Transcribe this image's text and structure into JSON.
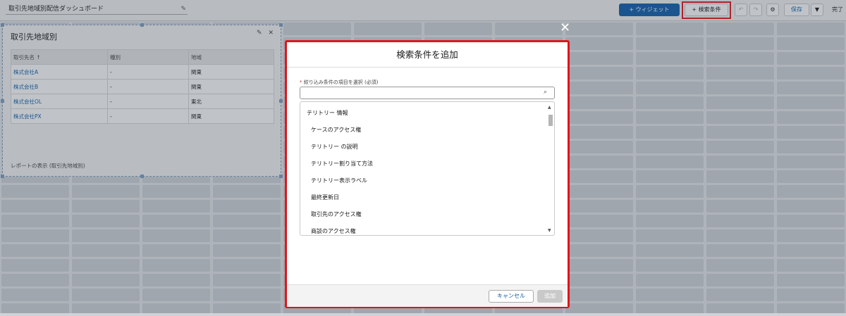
{
  "header": {
    "dashboard_title": "取引先地域別配信ダッシュボード",
    "widget_button": "+ ウィジェット",
    "filter_button": "+ 検索条件",
    "save_button": "保存",
    "done_label": "完了"
  },
  "widget": {
    "title": "取引先地域別",
    "columns": [
      "取引先名 ↑",
      "種別",
      "地域"
    ],
    "rows": [
      [
        "株式会社A",
        "-",
        "関東"
      ],
      [
        "株式会社B",
        "-",
        "関東"
      ],
      [
        "株式会社OL",
        "-",
        "東北"
      ],
      [
        "株式会社PX",
        "-",
        "関東"
      ]
    ],
    "footer": "レポートの表示 (取引先地域別)"
  },
  "modal": {
    "title": "検索条件を追加",
    "field_label_required": "*",
    "field_label": "絞り込み条件の項目を選択 (必須)",
    "search_value": "",
    "group_header": "テリトリー 情報",
    "options": [
      "ケースのアクセス権",
      "テリトリー の説明",
      "テリトリー割り当て方法",
      "テリトリー表示ラベル",
      "最終更新日",
      "取引先のアクセス権",
      "商談のアクセス権"
    ],
    "cancel_label": "キャンセル",
    "add_label": "追加"
  },
  "colors": {
    "brand": "#0b5cab",
    "highlight": "#e0151b"
  }
}
